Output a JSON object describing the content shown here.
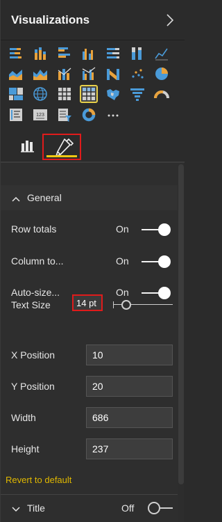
{
  "header": {
    "title": "Visualizations",
    "expand_icon": "chevron-right-icon"
  },
  "gallery": {
    "visual_icons": [
      "stacked-bar-chart-icon",
      "stacked-column-chart-icon",
      "clustered-bar-chart-icon",
      "clustered-column-chart-icon",
      "100-percent-stacked-bar-chart-icon",
      "100-percent-stacked-column-chart-icon",
      "line-chart-icon",
      "area-chart-icon",
      "stacked-area-chart-icon",
      "line-and-stacked-column-chart-icon",
      "line-and-clustered-column-chart-icon",
      "ribbon-chart-icon",
      "scatter-chart-icon",
      "pie-chart-icon",
      "treemap-icon",
      "map-icon",
      "table-icon",
      "matrix-icon",
      "filled-map-icon",
      "funnel-icon",
      "gauge-icon",
      "multi-row-card-icon",
      "card-icon",
      "slicer-icon",
      "donut-chart-icon",
      "more-options-icon"
    ],
    "selected": "matrix-icon",
    "more_label": "···"
  },
  "tabs": {
    "fields_icon": "fields-icon",
    "format_icon": "paint-roller-icon",
    "active": "format"
  },
  "format": {
    "general": {
      "header": "General",
      "row_totals": {
        "label": "Row totals",
        "state": "On"
      },
      "column_totals": {
        "label": "Column to...",
        "state": "On"
      },
      "auto_size": {
        "label": "Auto-size...",
        "state": "On"
      },
      "text_size": {
        "label": "Text Size",
        "value": "14 pt"
      },
      "x_position": {
        "label": "X Position",
        "value": "10"
      },
      "y_position": {
        "label": "Y Position",
        "value": "20"
      },
      "width": {
        "label": "Width",
        "value": "686"
      },
      "height": {
        "label": "Height",
        "value": "237"
      },
      "revert": "Revert to default"
    },
    "title": {
      "header": "Title",
      "state": "Off"
    }
  },
  "colors": {
    "accent": "#f2c811",
    "highlight_box": "#e01b1b",
    "revert_link": "#e0b800"
  }
}
